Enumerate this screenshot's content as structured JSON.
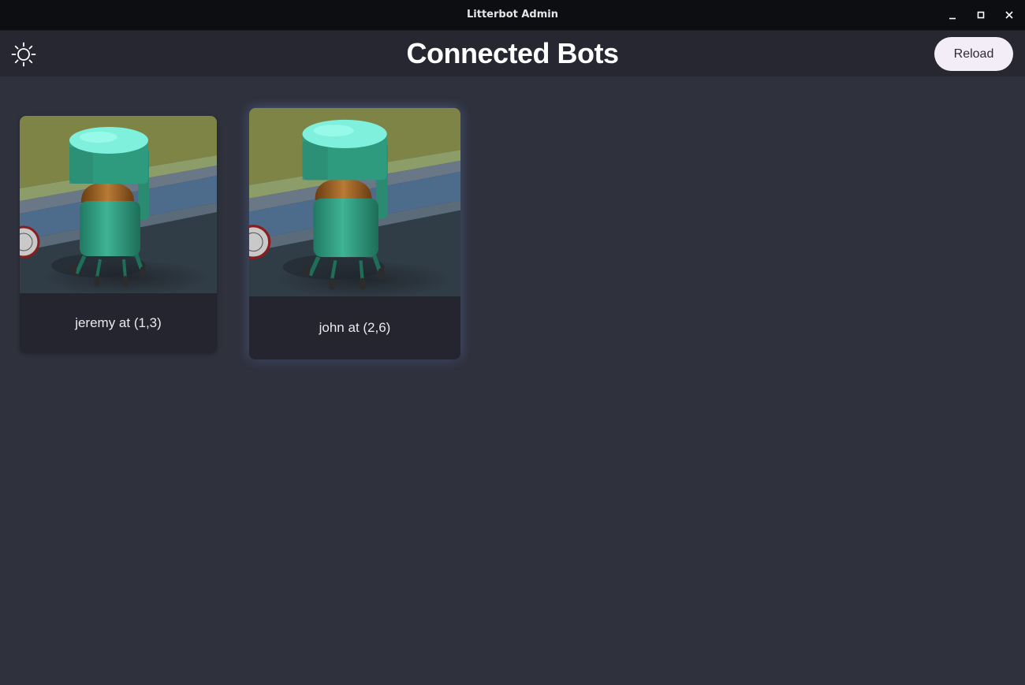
{
  "window": {
    "title": "Litterbot Admin"
  },
  "header": {
    "title": "Connected Bots",
    "theme_icon": "sun-icon",
    "reload_label": "Reload"
  },
  "bots": [
    {
      "label": "jeremy at (1,3)",
      "name": "jeremy",
      "position": "(1,3)"
    },
    {
      "label": "john at (2,6)",
      "name": "john",
      "position": "(2,6)"
    }
  ],
  "colors": {
    "background": "#2f313d",
    "header": "#262730",
    "titlebar": "#0d0e12",
    "card": "#24252e",
    "reload_button": "#f3edf7",
    "bot_body": "#2e9a7e",
    "bot_lid": "#7ff0dc"
  }
}
